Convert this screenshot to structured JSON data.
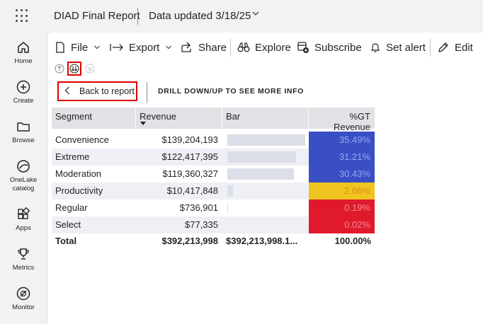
{
  "header": {
    "report_title": "DIAD Final Report",
    "data_updated": "Data updated 3/18/25"
  },
  "nav": {
    "home": "Home",
    "create": "Create",
    "browse": "Browse",
    "onelake_line1": "OneLake",
    "onelake_line2": "catalog",
    "apps": "Apps",
    "metrics": "Metrics",
    "monitor": "Monitor"
  },
  "toolbar": {
    "file": "File",
    "export": "Export",
    "share": "Share",
    "explore": "Explore",
    "subscribe": "Subscribe",
    "set_alert": "Set alert",
    "edit": "Edit"
  },
  "drill": {
    "back_label": "Back to report",
    "info": "DRILL DOWN/UP TO SEE MORE INFO"
  },
  "table": {
    "headers": [
      "Segment",
      "Revenue",
      "Bar",
      "%GT Revenue"
    ],
    "rows": [
      {
        "segment": "Convenience",
        "revenue": "$139,204,193",
        "bar_fraction": 1.0,
        "gt": "35.49%",
        "gt_color": "#3a4fc4",
        "gt_text": "#9aa6ee"
      },
      {
        "segment": "Extreme",
        "revenue": "$122,417,395",
        "bar_fraction": 0.8794,
        "gt": "31.21%",
        "gt_color": "#3a4fc4",
        "gt_text": "#9aa6ee"
      },
      {
        "segment": "Moderation",
        "revenue": "$119,360,327",
        "bar_fraction": 0.8575,
        "gt": "30.43%",
        "gt_color": "#3a4fc4",
        "gt_text": "#9aa6ee"
      },
      {
        "segment": "Productivity",
        "revenue": "$10,417,848",
        "bar_fraction": 0.0748,
        "gt": "2.66%",
        "gt_color": "#f0c520",
        "gt_text": "#e08a1a"
      },
      {
        "segment": "Regular",
        "revenue": "$736,901",
        "bar_fraction": 0.0053,
        "gt": "0.19%",
        "gt_color": "#e01a2c",
        "gt_text": "#f08a94"
      },
      {
        "segment": "Select",
        "revenue": "$77,335",
        "bar_fraction": 0.0006,
        "gt": "0.02%",
        "gt_color": "#e01a2c",
        "gt_text": "#f08a94"
      }
    ],
    "total": {
      "label": "Total",
      "revenue": "$392,213,998",
      "bar": "$392,213,998.1...",
      "gt": "100.00%"
    }
  }
}
